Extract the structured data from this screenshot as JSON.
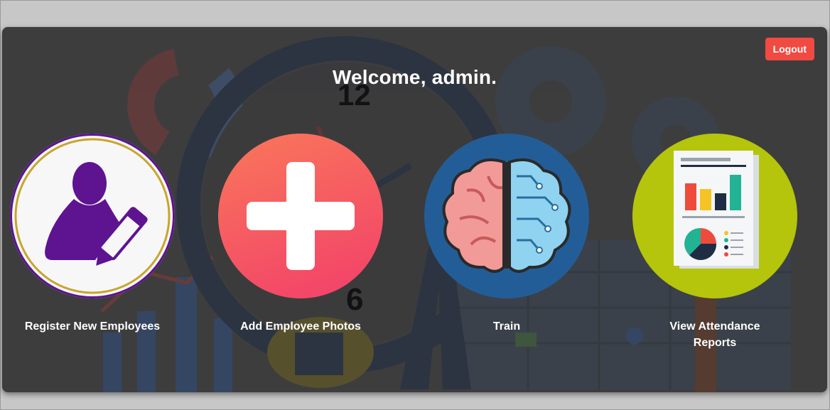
{
  "header": {
    "welcome": "Welcome, admin.",
    "logout_label": "Logout"
  },
  "cards": [
    {
      "label": "Register New Employees",
      "icon": "register-user-icon"
    },
    {
      "label": "Add Employee Photos",
      "icon": "plus-icon"
    },
    {
      "label": "Train",
      "icon": "brain-icon"
    },
    {
      "label": "View Attendance Reports",
      "icon": "report-icon"
    }
  ],
  "background": {
    "clock_numbers": [
      "12",
      "6"
    ]
  },
  "colors": {
    "logout": "#f14a42",
    "register_border": "#c8a52a",
    "register_icon": "#5e1391",
    "add_photos_gradient": [
      "#f76f55",
      "#f23f6a"
    ],
    "train_bg": "#235d97",
    "reports_bg": "#b4c50b"
  }
}
